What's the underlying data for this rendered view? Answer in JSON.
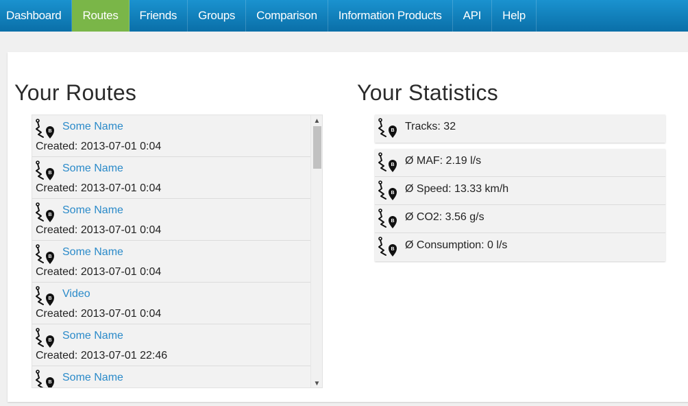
{
  "nav": {
    "items": [
      {
        "label": "Dashboard",
        "active": false
      },
      {
        "label": "Routes",
        "active": true
      },
      {
        "label": "Friends",
        "active": false
      },
      {
        "label": "Groups",
        "active": false
      },
      {
        "label": "Comparison",
        "active": false
      },
      {
        "label": "Information Products",
        "active": false
      },
      {
        "label": "API",
        "active": false
      },
      {
        "label": "Help",
        "active": false
      }
    ],
    "colors": {
      "bar": "#1282c0",
      "active": "#7ab648"
    }
  },
  "routes": {
    "title": "Your Routes",
    "icon": "route-marker-icon",
    "items": [
      {
        "name": "Some Name",
        "created": "Created: 2013-07-01 0:04"
      },
      {
        "name": "Some Name",
        "created": "Created: 2013-07-01 0:04"
      },
      {
        "name": "Some Name",
        "created": "Created: 2013-07-01 0:04"
      },
      {
        "name": "Some Name",
        "created": "Created: 2013-07-01 0:04"
      },
      {
        "name": "Video",
        "created": "Created: 2013-07-01 0:04"
      },
      {
        "name": "Some Name",
        "created": "Created: 2013-07-01 22:46"
      },
      {
        "name": "Some Name",
        "created": ""
      }
    ]
  },
  "statistics": {
    "title": "Your Statistics",
    "tracks": "Tracks: 32",
    "items": [
      "Ø MAF: 2.19 l/s",
      "Ø Speed: 13.33 km/h",
      "Ø CO2: 3.56 g/s",
      "Ø Consumption: 0 l/s"
    ]
  },
  "colors": {
    "link": "#2a8ac9",
    "item_bg": "#f2f2f2"
  }
}
